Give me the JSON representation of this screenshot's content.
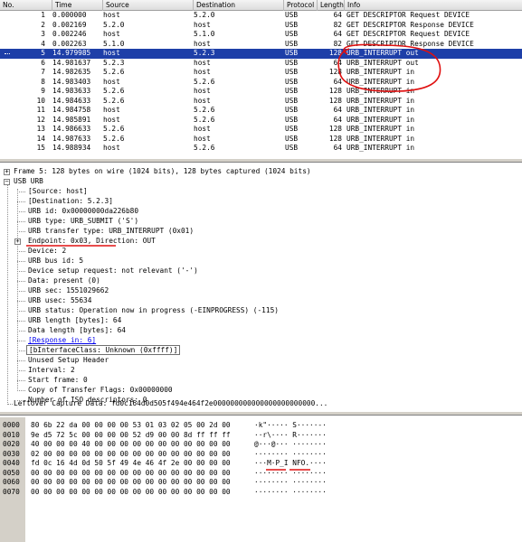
{
  "packet_list": {
    "headers": {
      "no": "No.",
      "time": "Time",
      "source": "Source",
      "destination": "Destination",
      "protocol": "Protocol",
      "length": "Length",
      "info": "Info"
    },
    "rows": [
      {
        "no": "1",
        "time": "0.000000",
        "source": "host",
        "destination": "5.2.0",
        "protocol": "USB",
        "length": "64",
        "info": "GET DESCRIPTOR Request DEVICE"
      },
      {
        "no": "2",
        "time": "0.002169",
        "source": "5.2.0",
        "destination": "host",
        "protocol": "USB",
        "length": "82",
        "info": "GET DESCRIPTOR Response DEVICE"
      },
      {
        "no": "3",
        "time": "0.002246",
        "source": "host",
        "destination": "5.1.0",
        "protocol": "USB",
        "length": "64",
        "info": "GET DESCRIPTOR Request DEVICE"
      },
      {
        "no": "4",
        "time": "0.002263",
        "source": "5.1.0",
        "destination": "host",
        "protocol": "USB",
        "length": "82",
        "info": "GET DESCRIPTOR Response DEVICE"
      },
      {
        "no": "5",
        "time": "14.979985",
        "source": "host",
        "destination": "5.2.3",
        "protocol": "USB",
        "length": "128",
        "info": "URB_INTERRUPT out"
      },
      {
        "no": "6",
        "time": "14.981637",
        "source": "5.2.3",
        "destination": "host",
        "protocol": "USB",
        "length": "64",
        "info": "URB_INTERRUPT out"
      },
      {
        "no": "7",
        "time": "14.982635",
        "source": "5.2.6",
        "destination": "host",
        "protocol": "USB",
        "length": "128",
        "info": "URB_INTERRUPT in"
      },
      {
        "no": "8",
        "time": "14.983403",
        "source": "host",
        "destination": "5.2.6",
        "protocol": "USB",
        "length": "64",
        "info": "URB_INTERRUPT in"
      },
      {
        "no": "9",
        "time": "14.983633",
        "source": "5.2.6",
        "destination": "host",
        "protocol": "USB",
        "length": "128",
        "info": "URB_INTERRUPT in"
      },
      {
        "no": "10",
        "time": "14.984633",
        "source": "5.2.6",
        "destination": "host",
        "protocol": "USB",
        "length": "128",
        "info": "URB_INTERRUPT in"
      },
      {
        "no": "11",
        "time": "14.984758",
        "source": "host",
        "destination": "5.2.6",
        "protocol": "USB",
        "length": "64",
        "info": "URB_INTERRUPT in"
      },
      {
        "no": "12",
        "time": "14.985891",
        "source": "host",
        "destination": "5.2.6",
        "protocol": "USB",
        "length": "64",
        "info": "URB_INTERRUPT in"
      },
      {
        "no": "13",
        "time": "14.986633",
        "source": "5.2.6",
        "destination": "host",
        "protocol": "USB",
        "length": "128",
        "info": "URB_INTERRUPT in"
      },
      {
        "no": "14",
        "time": "14.987633",
        "source": "5.2.6",
        "destination": "host",
        "protocol": "USB",
        "length": "128",
        "info": "URB_INTERRUPT in"
      },
      {
        "no": "15",
        "time": "14.988934",
        "source": "host",
        "destination": "5.2.6",
        "protocol": "USB",
        "length": "64",
        "info": "URB_INTERRUPT in"
      }
    ],
    "selected_no": "5"
  },
  "detail_tree": {
    "frame": "Frame 5: 128 bytes on wire (1024 bits), 128 bytes captured (1024 bits)",
    "usb_urb": "USB URB",
    "source": "[Source: host]",
    "destination": "[Destination: 5.2.3]",
    "urb_id": "URB id: 0x00000000da226b80",
    "urb_type": "URB type: URB_SUBMIT ('S')",
    "urb_transfer_type": "URB transfer type: URB_INTERRUPT (0x01)",
    "endpoint": "Endpoint: 0x03, Direction: OUT",
    "device": "Device: 2",
    "urb_bus_id": "URB bus id: 5",
    "device_setup_request": "Device setup request: not relevant ('-')",
    "data": "Data: present (0)",
    "urb_sec": "URB sec: 1551029662",
    "urb_usec": "URB usec: 55634",
    "urb_status": "URB status: Operation now in progress (-EINPROGRESS) (-115)",
    "urb_length": "URB length [bytes]: 64",
    "data_length": "Data length [bytes]: 64",
    "response_in": "[Response in: 6]",
    "binterface_class": "[bInterfaceClass: Unknown (0xffff)]",
    "unused_setup_header": "Unused Setup Header",
    "interval": "Interval: 2",
    "start_frame": "Start frame: 0",
    "copy_transfer_flags": "Copy of Transfer Flags: 0x00000000",
    "iso_descriptors": "Number of ISO descriptors: 0",
    "leftover": "Leftover Capture Data: fd0c164d0d505f494e464f2e000000000000000000000000..."
  },
  "hex_pane": {
    "rows": [
      {
        "offset": "0000",
        "bytes": "80 6b 22 da 00 00 00 00  53 01 03 02 05 00 2d 00",
        "ascii": "·k\"····· S·····-·"
      },
      {
        "offset": "0010",
        "bytes": "9e d5 72 5c 00 00 00 00  52 d9 00 00 8d ff ff ff",
        "ascii": "··r\\···· R·······"
      },
      {
        "offset": "0020",
        "bytes": "40 00 00 00 40 00 00 00  00 00 00 00 00 00 00 00",
        "ascii": "@···@··· ········"
      },
      {
        "offset": "0030",
        "bytes": "02 00 00 00 00 00 00 00  00 00 00 00 00 00 00 00",
        "ascii": "········ ········"
      },
      {
        "offset": "0040",
        "bytes": "fd 0c 16 4d 0d 50 5f 49  4e 46 4f 2e 00 00 00 00",
        "ascii": "···M·P_I NFO.····"
      },
      {
        "offset": "0050",
        "bytes": "00 00 00 00 00 00 00 00  00 00 00 00 00 00 00 00",
        "ascii": "········ ········"
      },
      {
        "offset": "0060",
        "bytes": "00 00 00 00 00 00 00 00  00 00 00 00 00 00 00 00",
        "ascii": "········ ········"
      },
      {
        "offset": "0070",
        "bytes": "00 00 00 00 00 00 00 00  00 00 00 00 00 00 00 00",
        "ascii": "········ ········"
      }
    ]
  },
  "colors": {
    "selected_row": "#1e3fa8",
    "annotation": "#e01010",
    "link": "#0000ee",
    "gutter": "#d4d0c8"
  }
}
